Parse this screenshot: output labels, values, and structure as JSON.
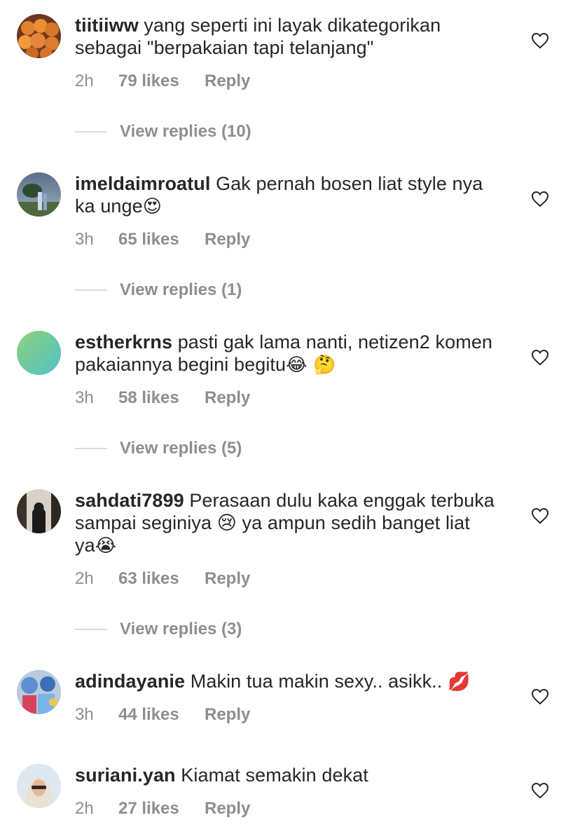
{
  "comments": [
    {
      "username": "tiitiiww",
      "text": "yang seperti ini layak dikategorikan sebagai \"berpakaian tapi telanjang\"",
      "time": "2h",
      "likes": "79 likes",
      "reply": "Reply",
      "view_replies": "View replies (10)",
      "avatar": "oranges-photo"
    },
    {
      "username": "imeldaimroatul",
      "text": "Gak pernah bosen liat style nya ka unge",
      "emoji": "😍",
      "time": "3h",
      "likes": "65 likes",
      "reply": "Reply",
      "view_replies": "View replies (1)",
      "avatar": "outdoor-couple-photo"
    },
    {
      "username": "estherkrns",
      "text": "pasti gak lama nanti, netizen2 komen pakaiannya begini begitu",
      "emoji": "😂 🤔",
      "time": "3h",
      "likes": "58 likes",
      "reply": "Reply",
      "view_replies": "View replies (5)",
      "avatar": "green-gradient"
    },
    {
      "username": "sahdati7899",
      "text": "Perasaan dulu kaka enggak terbuka sampai seginiya 😢 ya ampun sedih banget liat ya",
      "emoji": "😭",
      "time": "2h",
      "likes": "63 likes",
      "reply": "Reply",
      "view_replies": "View replies (3)",
      "avatar": "dark-portrait-photo"
    },
    {
      "username": "adindayanie",
      "text": "Makin tua makin sexy.. asikk..",
      "emoji": "💋",
      "time": "3h",
      "likes": "44 likes",
      "reply": "Reply",
      "avatar": "colorful-photo"
    },
    {
      "username": "suriani.yan",
      "text": "Kiamat semakin dekat",
      "time": "2h",
      "likes": "27 likes",
      "reply": "Reply",
      "avatar": "selfie-photo"
    }
  ],
  "colors": {
    "text": "#262626",
    "secondary": "#8e8e8e",
    "divider": "#dbdbdb"
  },
  "icons": {
    "like": "heart-outline-icon"
  }
}
